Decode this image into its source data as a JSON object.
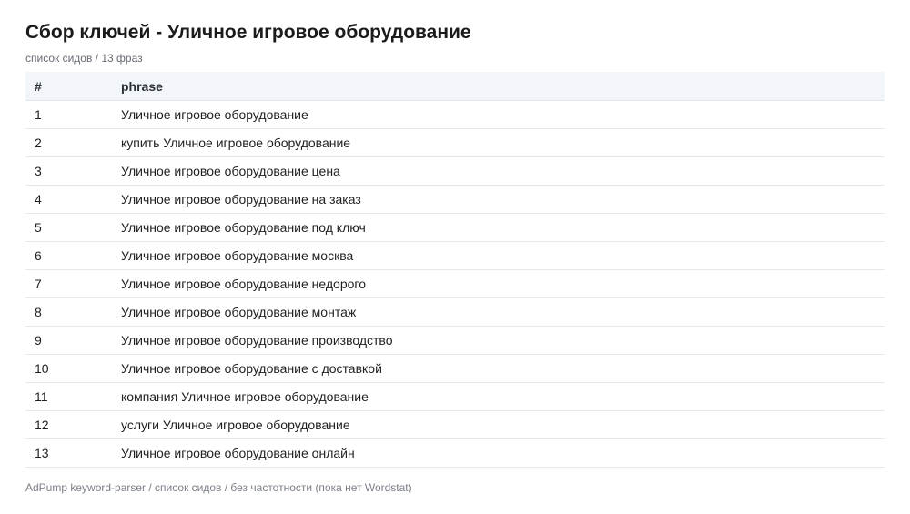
{
  "header": {
    "title": "Сбор ключей - Уличное игровое оборудование",
    "subtitle": "список сидов / 13 фраз"
  },
  "table": {
    "columns": [
      "#",
      "phrase"
    ],
    "rows": [
      {
        "num": "1",
        "phrase": "Уличное игровое оборудование"
      },
      {
        "num": "2",
        "phrase": "купить Уличное игровое оборудование"
      },
      {
        "num": "3",
        "phrase": "Уличное игровое оборудование цена"
      },
      {
        "num": "4",
        "phrase": "Уличное игровое оборудование на заказ"
      },
      {
        "num": "5",
        "phrase": "Уличное игровое оборудование под ключ"
      },
      {
        "num": "6",
        "phrase": "Уличное игровое оборудование москва"
      },
      {
        "num": "7",
        "phrase": "Уличное игровое оборудование недорого"
      },
      {
        "num": "8",
        "phrase": "Уличное игровое оборудование монтаж"
      },
      {
        "num": "9",
        "phrase": "Уличное игровое оборудование производство"
      },
      {
        "num": "10",
        "phrase": "Уличное игровое оборудование с доставкой"
      },
      {
        "num": "11",
        "phrase": "компания Уличное игровое оборудование"
      },
      {
        "num": "12",
        "phrase": "услуги Уличное игровое оборудование"
      },
      {
        "num": "13",
        "phrase": "Уличное игровое оборудование онлайн"
      }
    ]
  },
  "footer": {
    "text": "AdPump keyword-parser / список сидов / без частотности (пока нет Wordstat)"
  }
}
